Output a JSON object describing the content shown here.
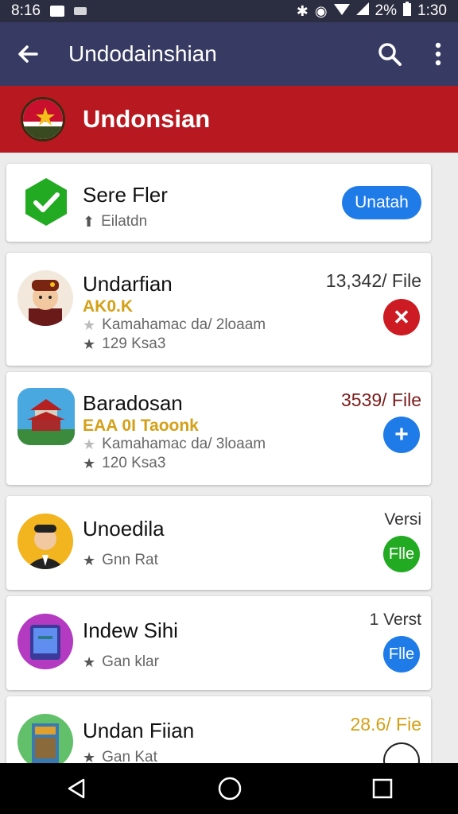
{
  "status": {
    "time": "8:16",
    "battery": "2%",
    "clock": "1:30"
  },
  "appbar": {
    "title": "Undodainshian"
  },
  "banner": {
    "title": "Undonsian"
  },
  "cards": [
    {
      "name": "Sere Fler",
      "meta": "Eilatdn",
      "action": "Unatah"
    },
    {
      "name": "Undarfian",
      "tag": "AK0.K",
      "publisher": "Kamahamac da/ 2loaam",
      "rating": "129 Ksa3",
      "size": "13,342/ File"
    },
    {
      "name": "Baradosan",
      "tag": "EAA 0I Taoonk",
      "publisher": "Kamahamac da/ 3loaam",
      "rating": "120 Ksa3",
      "size": "3539/ File"
    },
    {
      "name": "Unoedila",
      "meta": "Gnn Rat",
      "version": "Versi",
      "action": "Flle"
    },
    {
      "name": "Indew Sihi",
      "meta": "Gan klar",
      "version": "1 Verst",
      "action": "Flle"
    },
    {
      "name": "Undan Fiian",
      "meta": "Gan Kat",
      "size": "28.6/ Fie"
    }
  ],
  "colors": {
    "appbar": "#373a62",
    "banner": "#b8181f",
    "blue": "#1e7be8",
    "green": "#22aa22",
    "red": "#cc1b22",
    "gold": "#d4a017"
  },
  "icons": [
    "back-arrow-icon",
    "search-icon",
    "more-vert-icon",
    "check-icon",
    "star-icon",
    "plus-icon",
    "nav-back-icon",
    "nav-home-icon",
    "nav-recents-icon"
  ]
}
